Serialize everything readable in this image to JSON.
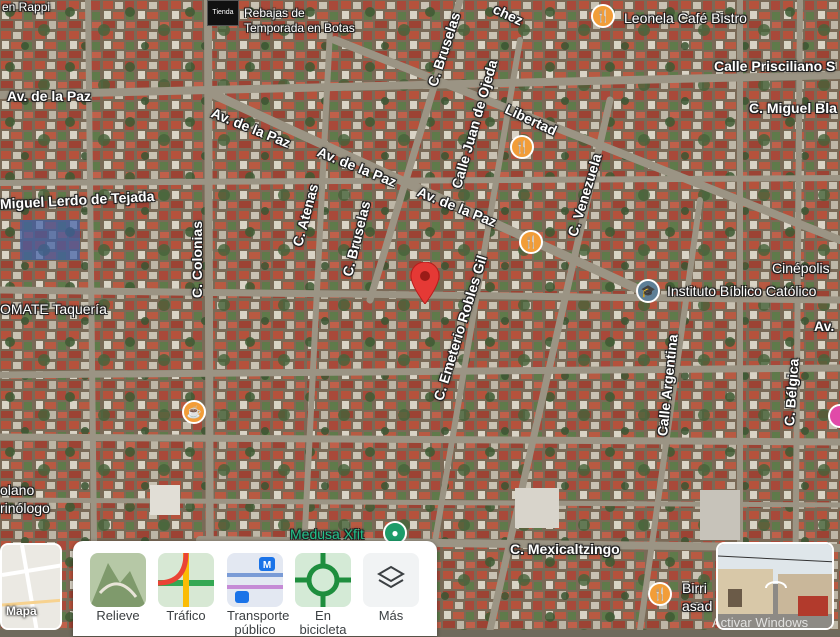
{
  "streets": {
    "av_paz_left": "Av. de la Paz",
    "av_paz_mid": "Av. de la Paz",
    "av_paz_center": "Av. de la Paz",
    "av_paz_right": "Av. de la Paz",
    "colonias": "C. Colonias",
    "atenas": "C. Atenas",
    "bruselas_top": "C. Bruselas",
    "bruselas_mid": "C. Bruselas",
    "juan_ojeda": "Calle Juan de Ojeda",
    "libertad": "Libertad",
    "venezuela": "C. Venezuela",
    "robles_gil": "C. Emeterio Robles Gil",
    "argentina": "Calle Argentina",
    "belgica": "C. Bélgica",
    "mexicaltzingo": "C. Mexicaltzingo",
    "lerdo": "Miguel Lerdo de Tejada",
    "prisciliano": "Calle Prisciliano S",
    "miguel_bla": "C. Miguel Bla",
    "chez": "chez",
    "av_right": "Av."
  },
  "places": {
    "rappi": "en Rappi",
    "rebajas": [
      "Rebajas de",
      "Temporada en Botas"
    ],
    "leonela": "Leonela Café Bistro",
    "cinepolis": "Cinépolis",
    "instituto": "Instituto Bíblico Católico",
    "omate": "OMATE Taquería",
    "medusa": "Medusa Xfit",
    "olano": [
      "olano",
      "rinólogo"
    ],
    "birria": [
      "Birri",
      "asad"
    ],
    "ad_box": "Tienda"
  },
  "layers": {
    "mapa": "Mapa",
    "relieve": "Relieve",
    "trafico": "Tráfico",
    "transporte": [
      "Transporte",
      "público"
    ],
    "bicicleta": [
      "En",
      "bicicleta"
    ],
    "mas": "Más"
  },
  "watermark": "Activar Windows",
  "colors": {
    "poi_food": "#f29d38",
    "poi_edu": "#5e7f96",
    "poi_gym": "#1d9c6a",
    "pin": "#e53935",
    "road": "#9b9484"
  }
}
